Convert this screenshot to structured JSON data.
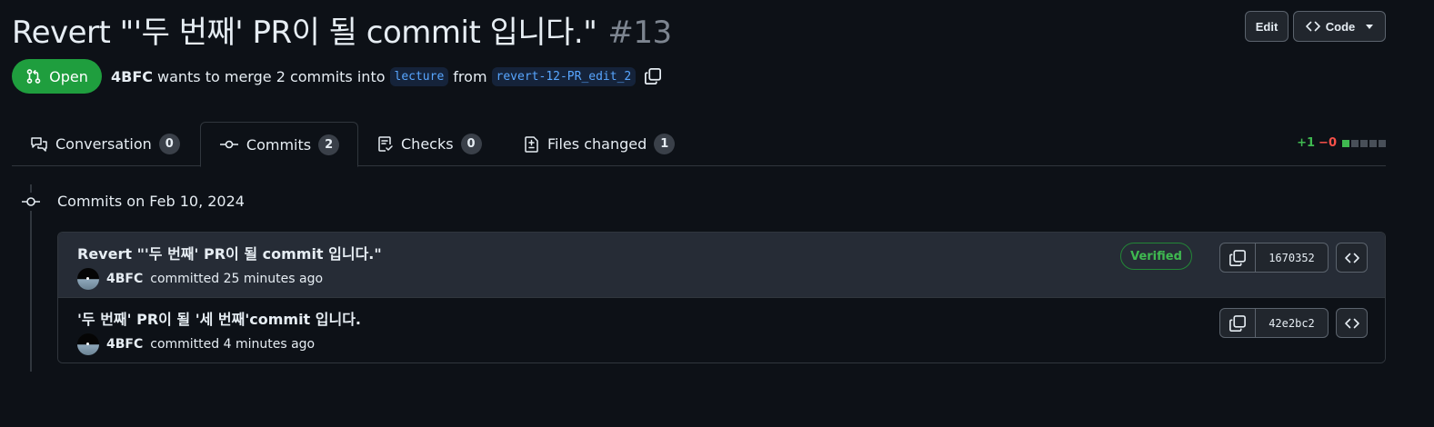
{
  "pr": {
    "title": "Revert \"'두 번째' PR이 될 commit 입니다.\"",
    "number": "#13",
    "state": "Open",
    "author": "4BFC",
    "merge_text": "wants to merge 2 commits into",
    "base_branch": "lecture",
    "from_text": "from",
    "head_branch": "revert-12-PR_edit_2"
  },
  "header_actions": {
    "edit": "Edit",
    "code": "Code"
  },
  "tabs": [
    {
      "label": "Conversation",
      "count": "0",
      "icon": "comment-discussion-icon"
    },
    {
      "label": "Commits",
      "count": "2",
      "icon": "git-commit-icon",
      "active": true
    },
    {
      "label": "Checks",
      "count": "0",
      "icon": "checklist-icon"
    },
    {
      "label": "Files changed",
      "count": "1",
      "icon": "file-diff-icon"
    }
  ],
  "diffstat": {
    "additions": "+1",
    "deletions": "−0",
    "blocks": [
      "#3fb950",
      "#484f58",
      "#484f58",
      "#484f58",
      "#484f58"
    ]
  },
  "commits_group": {
    "date_label": "Commits on Feb 10, 2024",
    "commits": [
      {
        "message": "Revert \"'두 번째' PR이 될 commit 입니다.\"",
        "author": "4BFC",
        "time": "committed 25 minutes ago",
        "verified": "Verified",
        "sha": "1670352"
      },
      {
        "message": "'두 번째' PR이 될 '세 번째'commit 입니다.",
        "author": "4BFC",
        "time": "committed 4 minutes ago",
        "sha": "42e2bc2"
      }
    ]
  },
  "colors": {
    "background": "#0d1117",
    "open_green": "#1f9e3e",
    "border": "#30363d",
    "branch_blue": "#58a6ff"
  }
}
